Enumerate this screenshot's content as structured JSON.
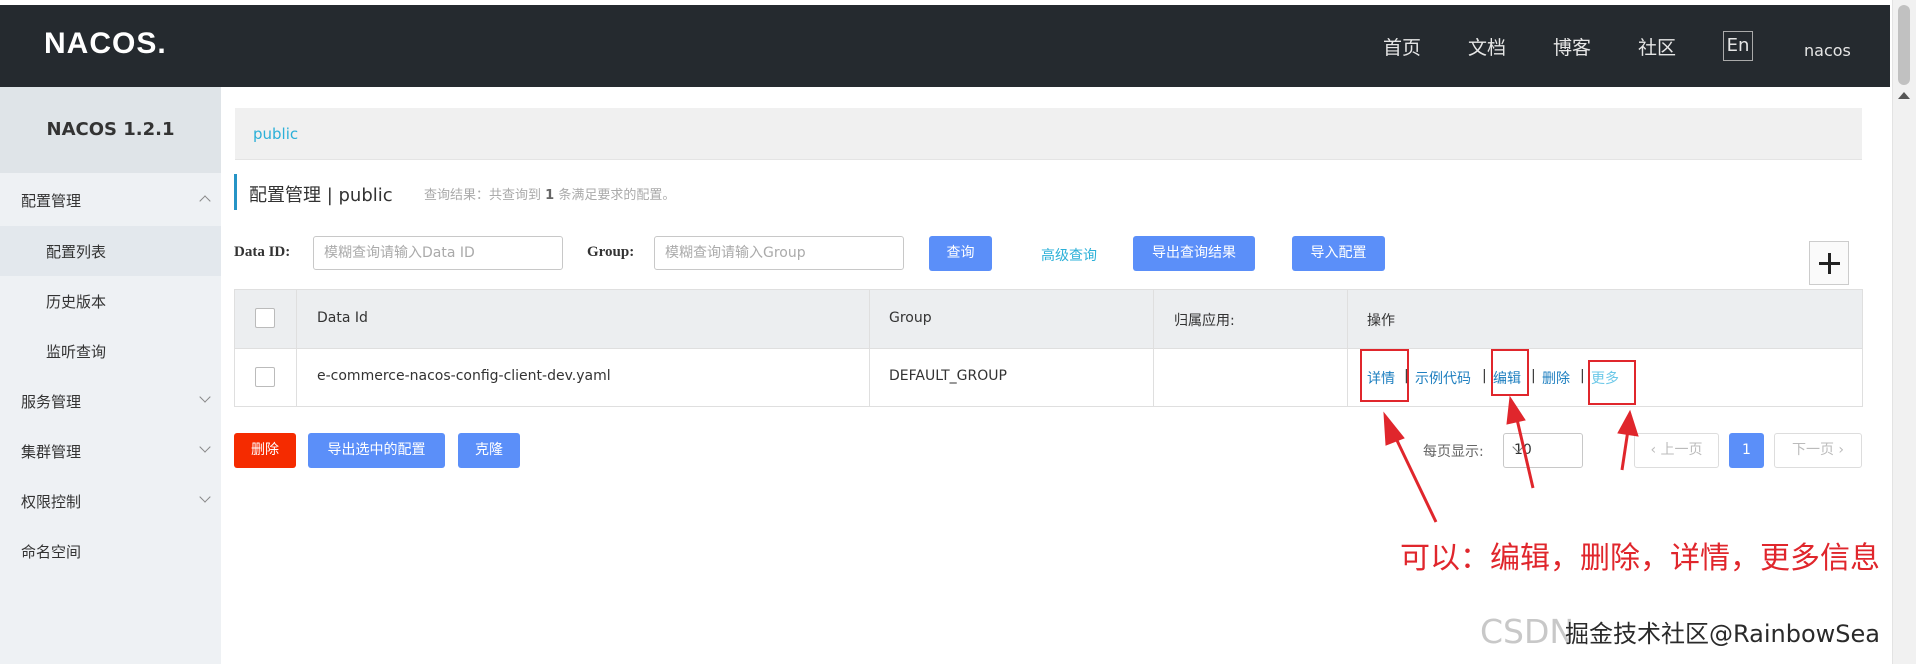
{
  "header": {
    "logo": "NACOS.",
    "nav": [
      "首页",
      "文档",
      "博客",
      "社区"
    ],
    "lang": "En",
    "user": "nacos"
  },
  "sidebar": {
    "version": "NACOS 1.2.1",
    "items": [
      {
        "label": "配置管理",
        "expanded": true
      },
      {
        "label": "配置列表",
        "sub": true,
        "active": true
      },
      {
        "label": "历史版本",
        "sub": true
      },
      {
        "label": "监听查询",
        "sub": true
      },
      {
        "label": "服务管理"
      },
      {
        "label": "集群管理"
      },
      {
        "label": "权限控制"
      },
      {
        "label": "命名空间"
      }
    ]
  },
  "breadcrumb": "public",
  "page_title": "配置管理 | public",
  "result_prefix": "查询结果：共查询到",
  "result_count": "1",
  "result_suffix": "条满足要求的配置。",
  "filters": {
    "data_id_label": "Data ID:",
    "data_id_placeholder": "模糊查询请输入Data ID",
    "group_label": "Group:",
    "group_placeholder": "模糊查询请输入Group",
    "search_button": "查询",
    "advanced_query": "高级查询",
    "export_results": "导出查询结果",
    "import_config": "导入配置"
  },
  "table": {
    "columns": [
      "Data Id",
      "Group",
      "归属应用:",
      "操作"
    ],
    "rows": [
      {
        "data_id": "e-commerce-nacos-config-client-dev.yaml",
        "group": "DEFAULT_GROUP",
        "app": "",
        "ops": [
          "详情",
          "示例代码",
          "编辑",
          "删除",
          "更多"
        ]
      }
    ]
  },
  "bottom_actions": {
    "delete": "删除",
    "export_selected": "导出选中的配置",
    "clone": "克隆"
  },
  "pager": {
    "label": "每页显示:",
    "page_size": "10",
    "prev": "上一页",
    "current": "1",
    "next": "下一页"
  },
  "annotation": "可以：编辑，删除，详情，更多信息",
  "watermark": "CSDN",
  "watermark_overlay": "掘金技术社区@RainbowSea",
  "colors": {
    "topbar": "#252a2f",
    "primary": "#5b8ff9",
    "danger": "#f52b00",
    "annotation": "#e0262c"
  }
}
